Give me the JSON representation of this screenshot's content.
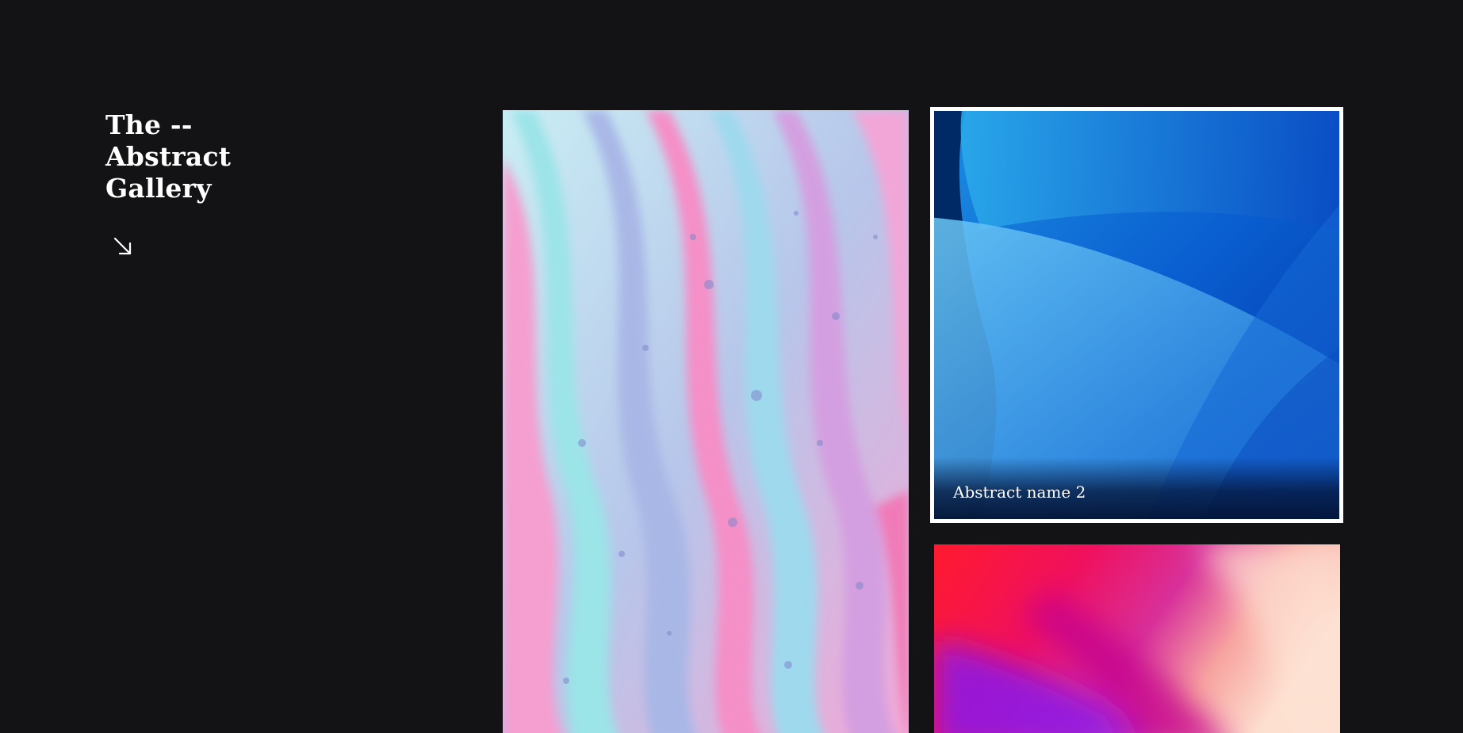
{
  "site": {
    "title_lines": [
      "The --",
      "Abstract",
      "Gallery"
    ],
    "scroll_icon": "arrow-down-right-icon"
  },
  "gallery": {
    "items": [
      {
        "caption": "",
        "palette": [
          "#b5dff0",
          "#f49ed1",
          "#8fe3e6",
          "#9d8fd6"
        ]
      },
      {
        "caption": "Abstract name 2",
        "palette": [
          "#0a5fd0",
          "#0032a8",
          "#4fb6f2",
          "#00214f"
        ]
      },
      {
        "caption": "",
        "palette": [
          "#ff1133",
          "#c4008f",
          "#8a14ea",
          "#fbd9c8"
        ]
      }
    ],
    "selected_index": 1
  },
  "colors": {
    "background": "#131316",
    "text": "#ffffff",
    "selection_border": "#ffffff"
  }
}
